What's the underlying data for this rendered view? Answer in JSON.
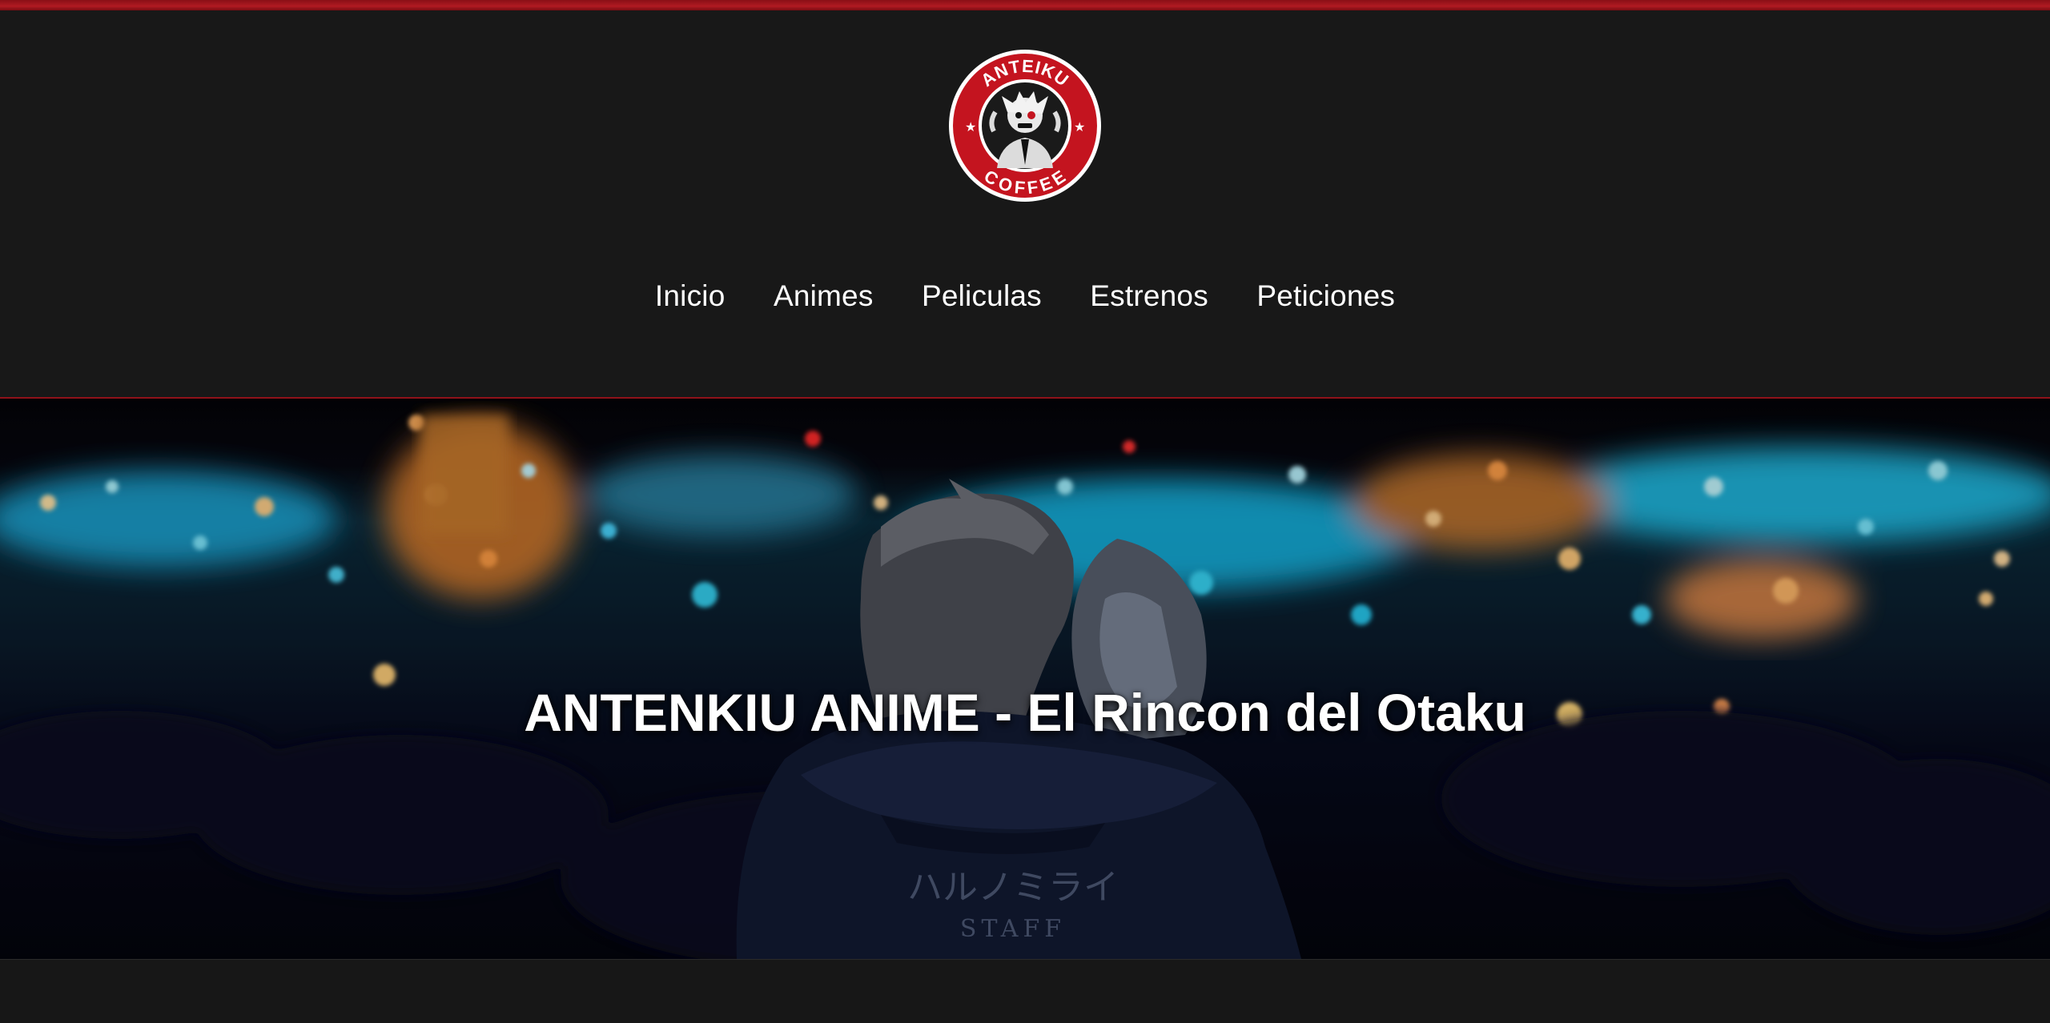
{
  "logo": {
    "top_text": "ANTEIKU",
    "bottom_text": "COFFEE",
    "colors": {
      "ring": "#c4141f",
      "inner": "#ffffff",
      "figure": "#111111"
    }
  },
  "nav": {
    "items": [
      {
        "label": "Inicio"
      },
      {
        "label": "Animes"
      },
      {
        "label": "Peliculas"
      },
      {
        "label": "Estrenos"
      },
      {
        "label": "Peticiones"
      }
    ]
  },
  "hero": {
    "title": "ANTENKIU ANIME - El Rincon del Otaku",
    "hoodie_text": "ハルノミライ",
    "hoodie_subtext": "STAFF"
  },
  "colors": {
    "accent": "#b01a22",
    "background": "#181818",
    "text": "#ffffff"
  }
}
